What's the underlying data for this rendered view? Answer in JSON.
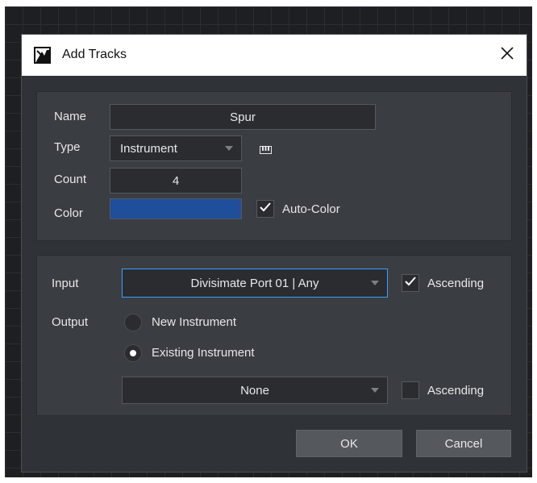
{
  "dialog": {
    "title": "Add Tracks",
    "title_icon": "add-tracks-icon",
    "close_icon": "close-icon"
  },
  "track": {
    "name_label": "Name",
    "name_value": "Spur",
    "type_label": "Type",
    "type_value": "Instrument",
    "type_icon": "keyboard-icon",
    "count_label": "Count",
    "count_value": "4",
    "color_label": "Color",
    "color_value": "#1f4e9a",
    "auto_color_label": "Auto-Color",
    "auto_color_checked": true
  },
  "routing": {
    "input_label": "Input",
    "input_value": "Divisimate Port 01 | Any",
    "input_ascending_label": "Ascending",
    "input_ascending_checked": true,
    "output_label": "Output",
    "output_options": [
      {
        "label": "New Instrument",
        "selected": false
      },
      {
        "label": "Existing Instrument",
        "selected": true
      }
    ],
    "instrument_value": "None",
    "output_ascending_label": "Ascending",
    "output_ascending_checked": false
  },
  "buttons": {
    "ok_label": "OK",
    "cancel_label": "Cancel"
  }
}
